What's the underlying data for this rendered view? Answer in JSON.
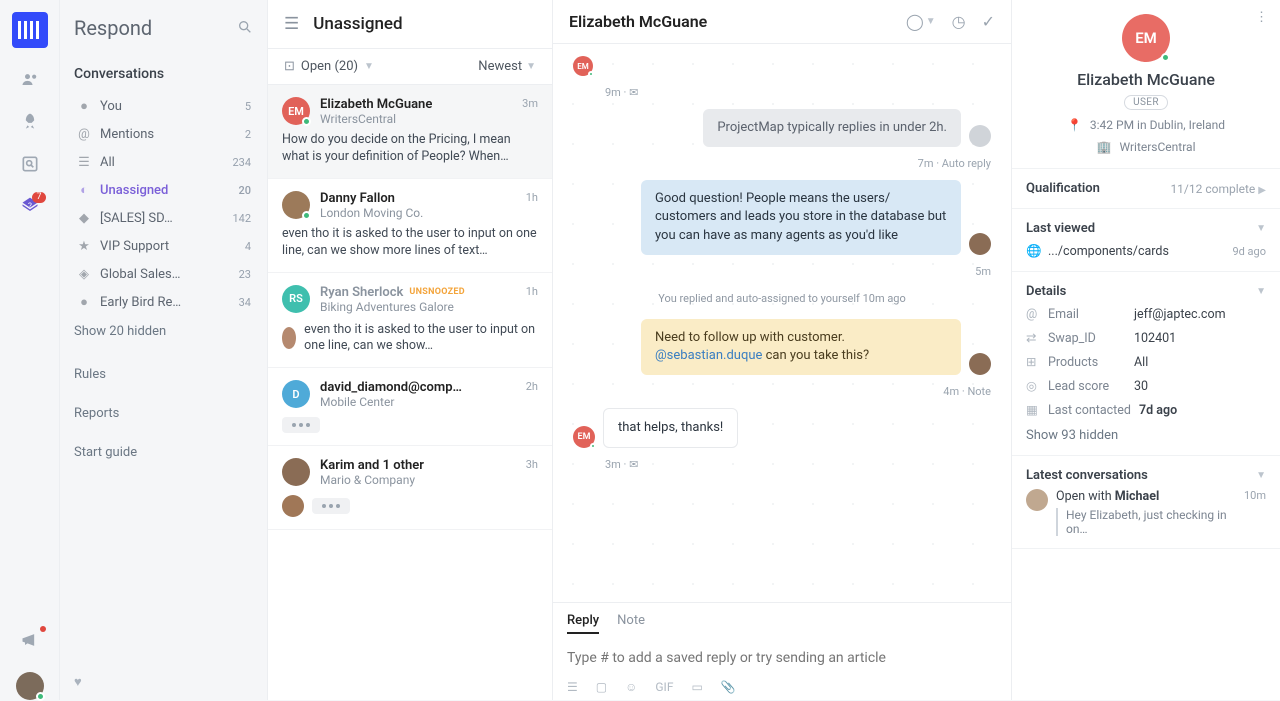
{
  "rail": {
    "help_badge": "7"
  },
  "sidebar": {
    "title": "Respond",
    "section": "Conversations",
    "items": [
      {
        "label": "You",
        "count": "5"
      },
      {
        "label": "Mentions",
        "count": "2"
      },
      {
        "label": "All",
        "count": "234"
      },
      {
        "label": "Unassigned",
        "count": "20"
      },
      {
        "label": "[SALES] SD…",
        "count": "142"
      },
      {
        "label": "VIP Support",
        "count": "4"
      },
      {
        "label": "Global Sales…",
        "count": "23"
      },
      {
        "label": "Early Bird Re…",
        "count": "34"
      }
    ],
    "show_hidden": "Show 20 hidden",
    "links": [
      "Rules",
      "Reports",
      "Start guide"
    ]
  },
  "inbox": {
    "header": "Unassigned",
    "filter": "Open (20)",
    "sort": "Newest",
    "convs": [
      {
        "initials": "EM",
        "name": "Elizabeth McGuane",
        "sub": "WritersCentral",
        "time": "3m",
        "preview": "How do you decide on the Pricing, I mean what is your definition of People? When…"
      },
      {
        "name": "Danny Fallon",
        "sub": "London Moving Co.",
        "time": "1h",
        "preview": "even tho it is asked to the user to input on one line, can we show more lines of text…"
      },
      {
        "initials": "RS",
        "name": "Ryan Sherlock",
        "sub": "Biking Adventures Galore",
        "time": "1h",
        "tag": "UNSNOOZED",
        "preview": "even tho it is asked to the user to input on one line, can we show…"
      },
      {
        "initials": "D",
        "name": "david_diamond@comp…",
        "sub": "Mobile Center",
        "time": "2h"
      },
      {
        "name": "Karim and 1 other",
        "sub": "Mario & Company",
        "time": "3h"
      }
    ]
  },
  "thread": {
    "title": "Elizabeth McGuane",
    "sys_msg": "ProjectMap typically replies in under 2h.",
    "sys_meta": "7m · Auto reply",
    "cust_time": "9m ·",
    "agent_msg": "Good question! People means the users/ customers and leads you store in the database but you can have as many agents as you'd like",
    "agent_meta": "5m",
    "sep": "You replied and auto-assigned to yourself 10m ago",
    "note_pre": "Need to follow up with customer. ",
    "note_mention": "@sebastian.duque",
    "note_post": " can you take this?",
    "note_meta": "4m · Note",
    "cust_msg": "that helps, thanks!",
    "cust_meta": "3m ·",
    "composer": {
      "reply": "Reply",
      "note": "Note",
      "placeholder": "Type # to add a saved reply or try sending an article",
      "gif": "GIF"
    }
  },
  "details": {
    "name": "Elizabeth McGuane",
    "initials": "EM",
    "role": "USER",
    "time_loc": "3:42 PM in Dublin, Ireland",
    "company": "WritersCentral",
    "qual": {
      "title": "Qualification",
      "meta": "11/12 complete"
    },
    "last_viewed": {
      "title": "Last viewed",
      "path": ".../components/cards",
      "when": "9d ago"
    },
    "detail": {
      "title": "Details",
      "email_k": "Email",
      "email_v": "jeff@japtec.com",
      "swap_k": "Swap_ID",
      "swap_v": "102401",
      "prod_k": "Products",
      "prod_v": "All",
      "lead_k": "Lead score",
      "lead_v": "30",
      "last_k": "Last contacted",
      "last_v": "7d ago",
      "show": "Show 93 hidden"
    },
    "latest": {
      "title": "Latest conversations",
      "line_pre": "Open with ",
      "line_who": "Michael",
      "when": "10m",
      "msg": "Hey Elizabeth, just checking in on…"
    }
  }
}
